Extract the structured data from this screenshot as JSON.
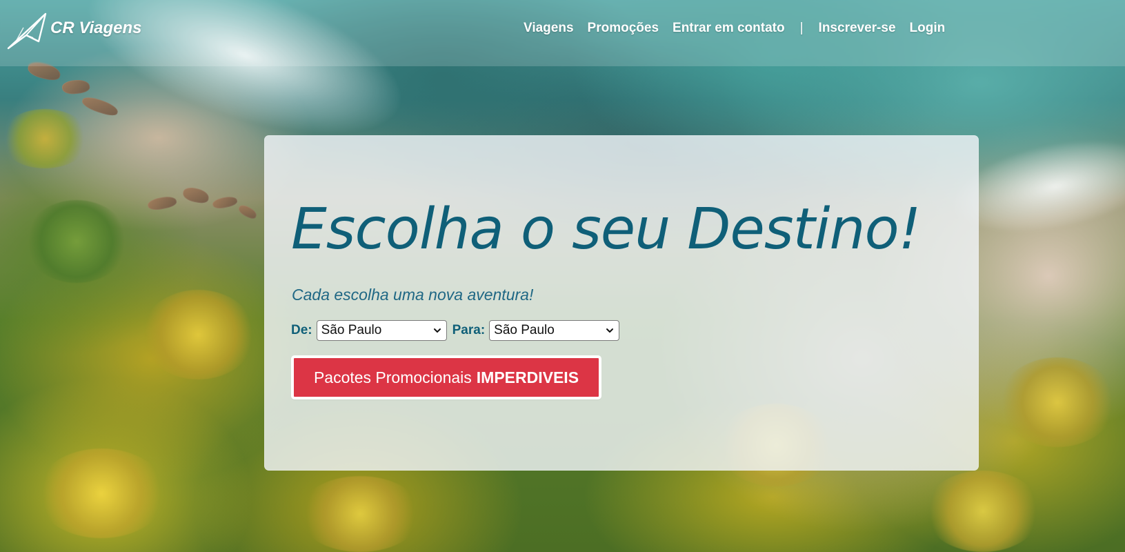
{
  "brand": {
    "name": "CR Viagens",
    "icon": "paper-plane-icon"
  },
  "navigation": {
    "items": [
      "Viagens",
      "Promoções",
      "Entrar em contato"
    ],
    "separator": "|",
    "auth": [
      "Inscrever-se",
      "Login"
    ]
  },
  "hero": {
    "title": "Escolha o seu Destino!",
    "subtitle": "Cada escolha uma nova aventura!",
    "from_label": "De:",
    "from_value": "São Paulo",
    "to_label": "Para:",
    "to_value": "São Paulo",
    "button_prefix": "Pacotes Promocionais",
    "button_emphasis": "IMPERDIVEIS"
  },
  "colors": {
    "title": "#0f5f78",
    "card_background": "#f0f4f8",
    "button": "#dc3545",
    "nav_text": "#ffffff"
  }
}
